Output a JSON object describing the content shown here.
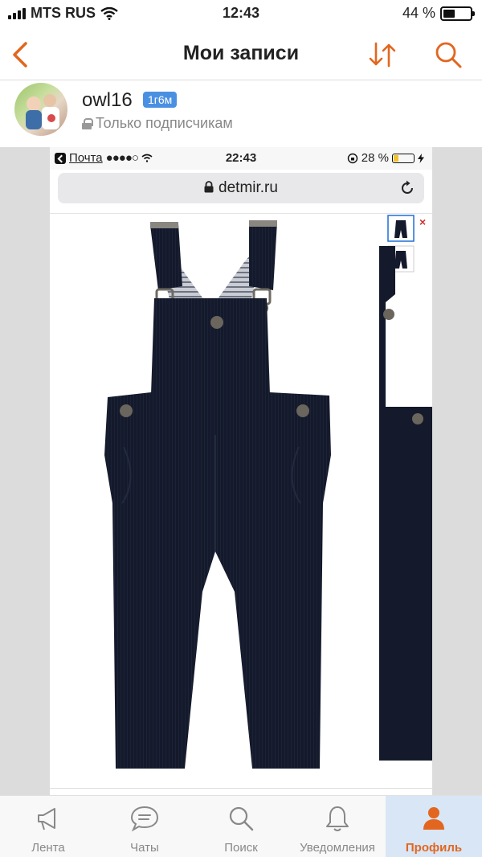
{
  "status_bar": {
    "carrier": "MTS RUS",
    "time": "12:43",
    "battery": "44 %",
    "battery_level": 0.44
  },
  "nav": {
    "title": "Мои записи"
  },
  "author": {
    "name": "owl16",
    "age_badge": "1г6м",
    "visibility": "Только подписчикам"
  },
  "screenshot": {
    "status": {
      "back_app": "Почта",
      "signal": "●●●●○",
      "time": "22:43",
      "battery": "28 %",
      "battery_level": 0.28
    },
    "url": "detmir.ru"
  },
  "tabs": [
    {
      "label": "Лента",
      "icon": "megaphone-icon"
    },
    {
      "label": "Чаты",
      "icon": "chat-bubble-icon"
    },
    {
      "label": "Поиск",
      "icon": "search-icon"
    },
    {
      "label": "Уведомления",
      "icon": "bell-icon"
    },
    {
      "label": "Профиль",
      "icon": "person-icon",
      "active": true
    }
  ],
  "colors": {
    "accent": "#e2661f",
    "badge": "#4a90e2",
    "overalls": "#141a2b"
  }
}
